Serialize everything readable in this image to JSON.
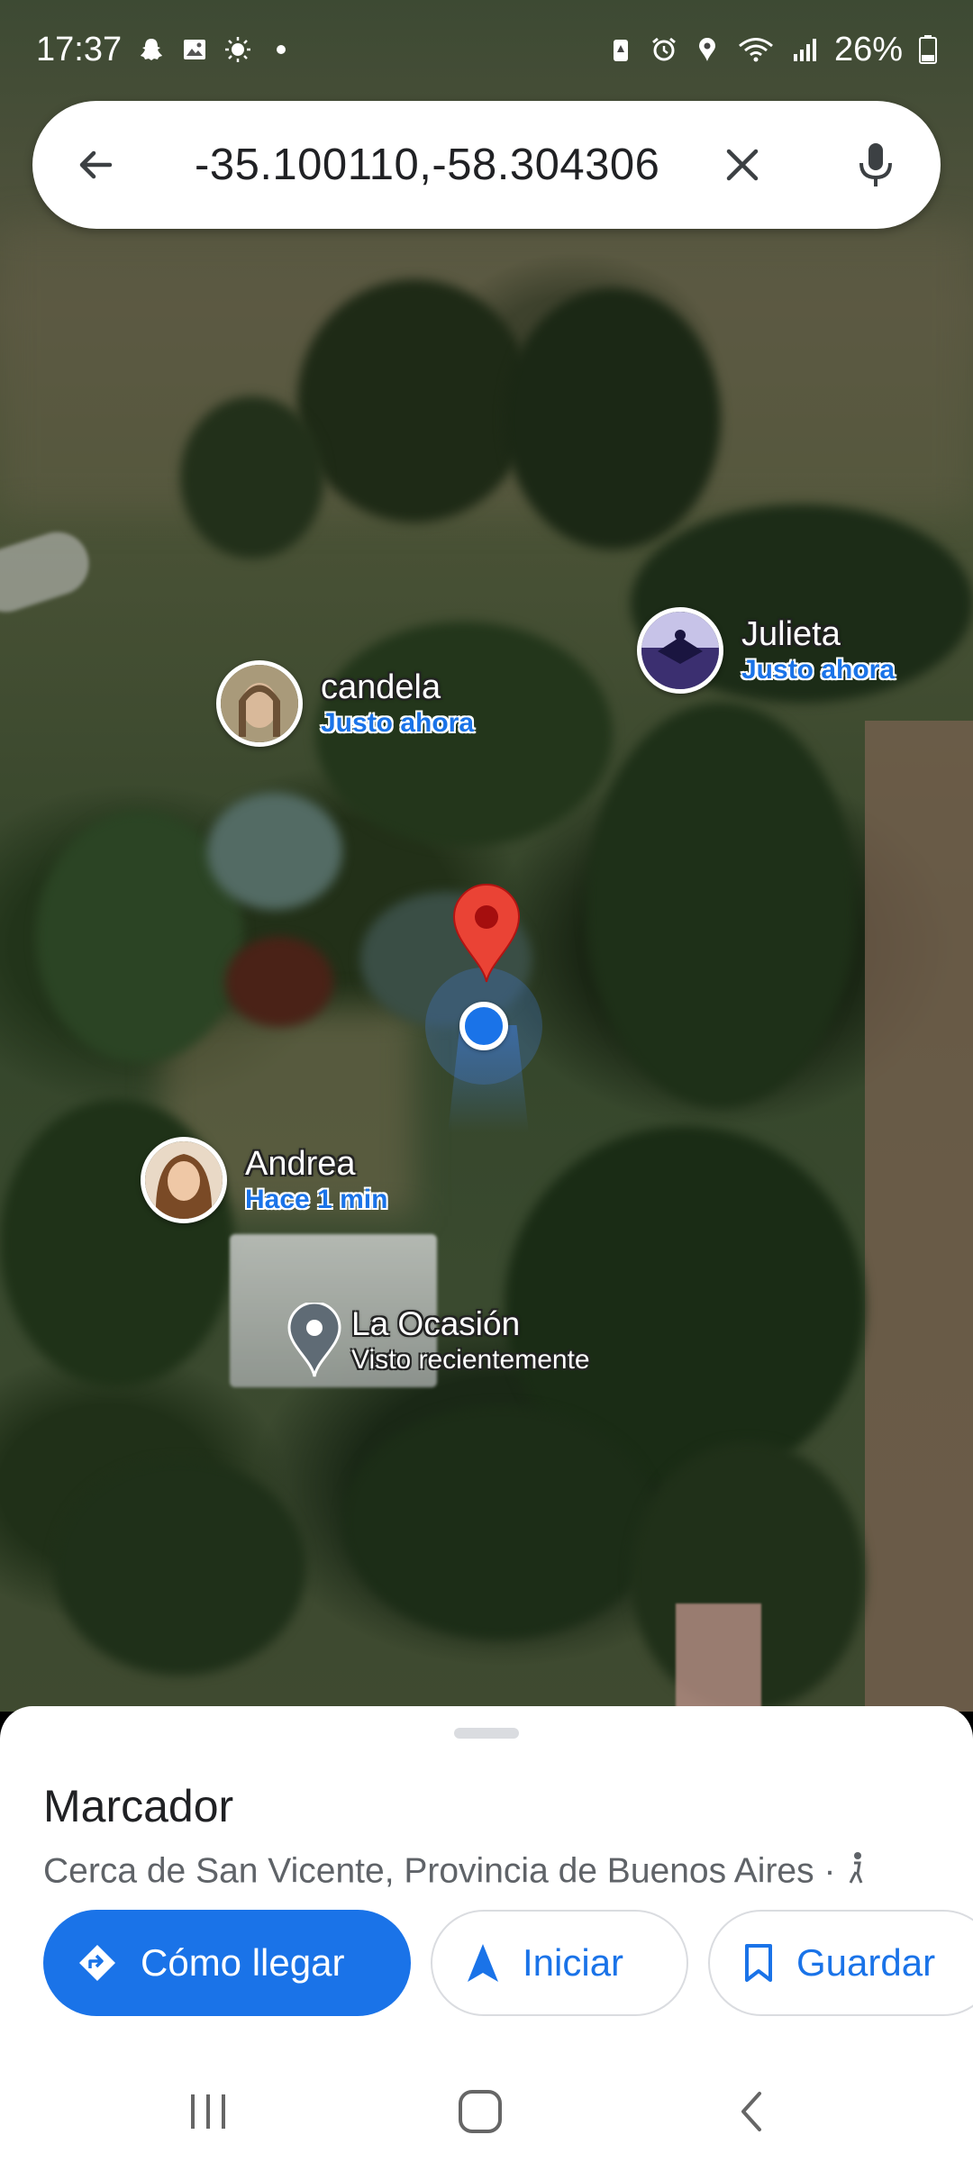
{
  "status_bar": {
    "time": "17:37",
    "battery": "26%",
    "left_icons": [
      "snapchat-icon",
      "image-icon",
      "brightness-icon",
      "dot-icon"
    ],
    "right_icons": [
      "battery-saver-icon",
      "alarm-icon",
      "location-icon",
      "wifi-icon",
      "signal-icon",
      "battery-icon"
    ]
  },
  "search": {
    "query": "-35.100110,-58.304306",
    "back_icon": "arrow-back-icon",
    "clear_icon": "close-icon",
    "voice_icon": "microphone-icon"
  },
  "map": {
    "people": [
      {
        "name": "Julieta",
        "time": "Justo ahora"
      },
      {
        "name": "candela",
        "time": "Justo ahora"
      },
      {
        "name": "Andrea",
        "time": "Hace 1 min"
      }
    ],
    "place": {
      "name": "La Ocasión",
      "subtitle": "Visto recientemente"
    },
    "colors": {
      "pin_red": "#ea4335",
      "location_blue": "#1a73e8",
      "time_blue": "#1a73e8"
    }
  },
  "sheet": {
    "title": "Marcador",
    "subtitle": "Cerca de San Vicente, Provincia de Buenos Aires · ",
    "actions": {
      "directions": "Cómo llegar",
      "start": "Iniciar",
      "save": "Guardar"
    }
  },
  "nav_bar": {
    "icons": [
      "recent-apps-icon",
      "home-icon",
      "back-icon"
    ]
  }
}
